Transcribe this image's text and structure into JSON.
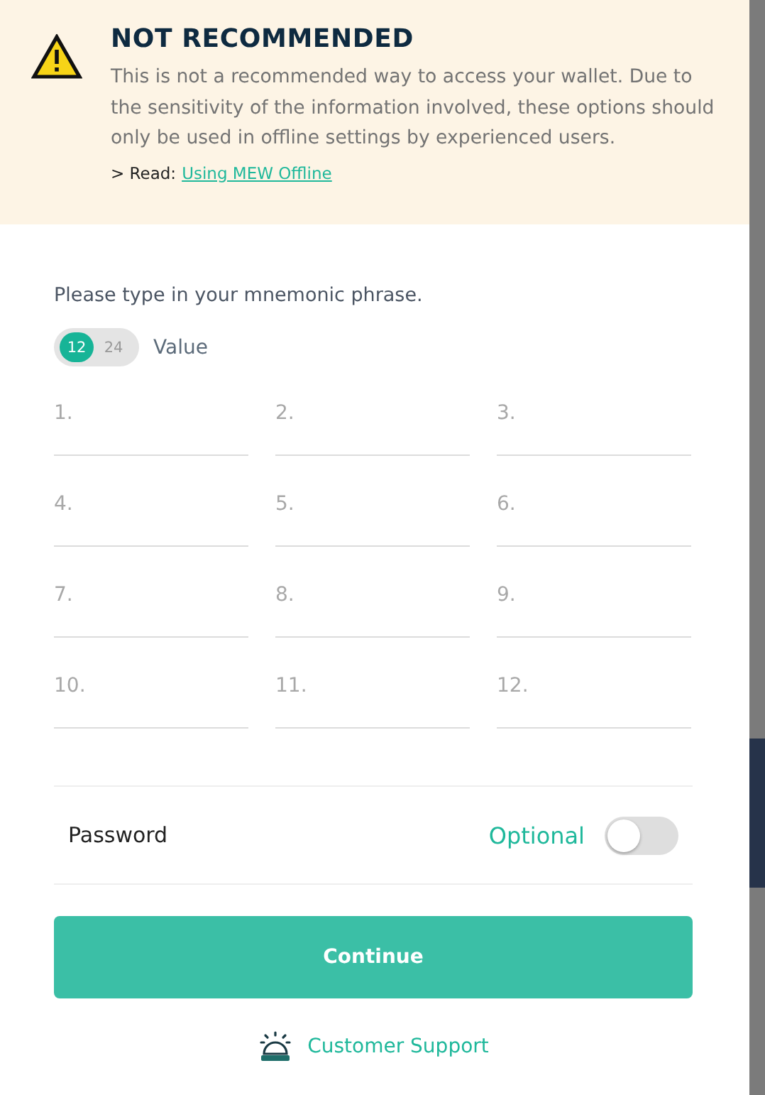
{
  "warning": {
    "title": "NOT RECOMMENDED",
    "message": "This is not a recommended way to access your wallet. Due to the sensitivity of the information involved, these options should only be used in offline settings by experienced users.",
    "read_prefix": "> Read:",
    "read_link": "Using MEW Offline"
  },
  "prompt": "Please type in your mnemonic phrase.",
  "length_options": [
    {
      "label": "12",
      "selected": true
    },
    {
      "label": "24",
      "selected": false
    }
  ],
  "length_label": "Value",
  "words": [
    {
      "placeholder": "1."
    },
    {
      "placeholder": "2."
    },
    {
      "placeholder": "3."
    },
    {
      "placeholder": "4."
    },
    {
      "placeholder": "5."
    },
    {
      "placeholder": "6."
    },
    {
      "placeholder": "7."
    },
    {
      "placeholder": "8."
    },
    {
      "placeholder": "9."
    },
    {
      "placeholder": "10."
    },
    {
      "placeholder": "11."
    },
    {
      "placeholder": "12."
    }
  ],
  "password": {
    "label": "Password",
    "hint": "Optional",
    "on": false
  },
  "continue_button": "Continue",
  "support_link": "Customer Support"
}
